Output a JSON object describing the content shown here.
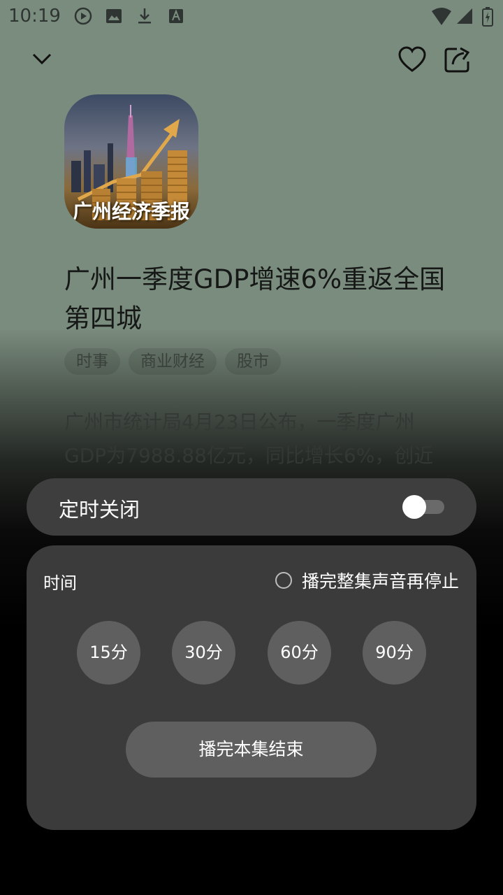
{
  "status_bar": {
    "time": "10:19",
    "left_icons": [
      "play-circle-icon",
      "image-icon",
      "download-icon",
      "text-a-icon"
    ],
    "right_icons": [
      "wifi-icon",
      "signal-icon",
      "battery-icon"
    ]
  },
  "top_bar": {
    "icons": [
      "chevron-down-icon",
      "heart-icon",
      "share-icon"
    ]
  },
  "episode": {
    "cover_caption": "广州经济季报",
    "title": "广州一季度GDP增速6%重返全国第四城",
    "tags": [
      "时事",
      "商业财经",
      "股市"
    ],
    "summary": "广州市统计局4月23日公布，一季度广州GDP为7988.88亿元，同比增长6%，创近"
  },
  "timer": {
    "label": "定时关闭",
    "enabled": false,
    "time_label": "时间",
    "finish_episode_option": "播完整集声音再停止",
    "finish_episode_checked": false,
    "durations": [
      "15分",
      "30分",
      "60分",
      "90分"
    ],
    "end_of_episode_button": "播完本集结束"
  },
  "colors": {
    "background_top": "#7a8c7d",
    "panel": "#3b3b3b",
    "button": "#5f5f5f"
  }
}
